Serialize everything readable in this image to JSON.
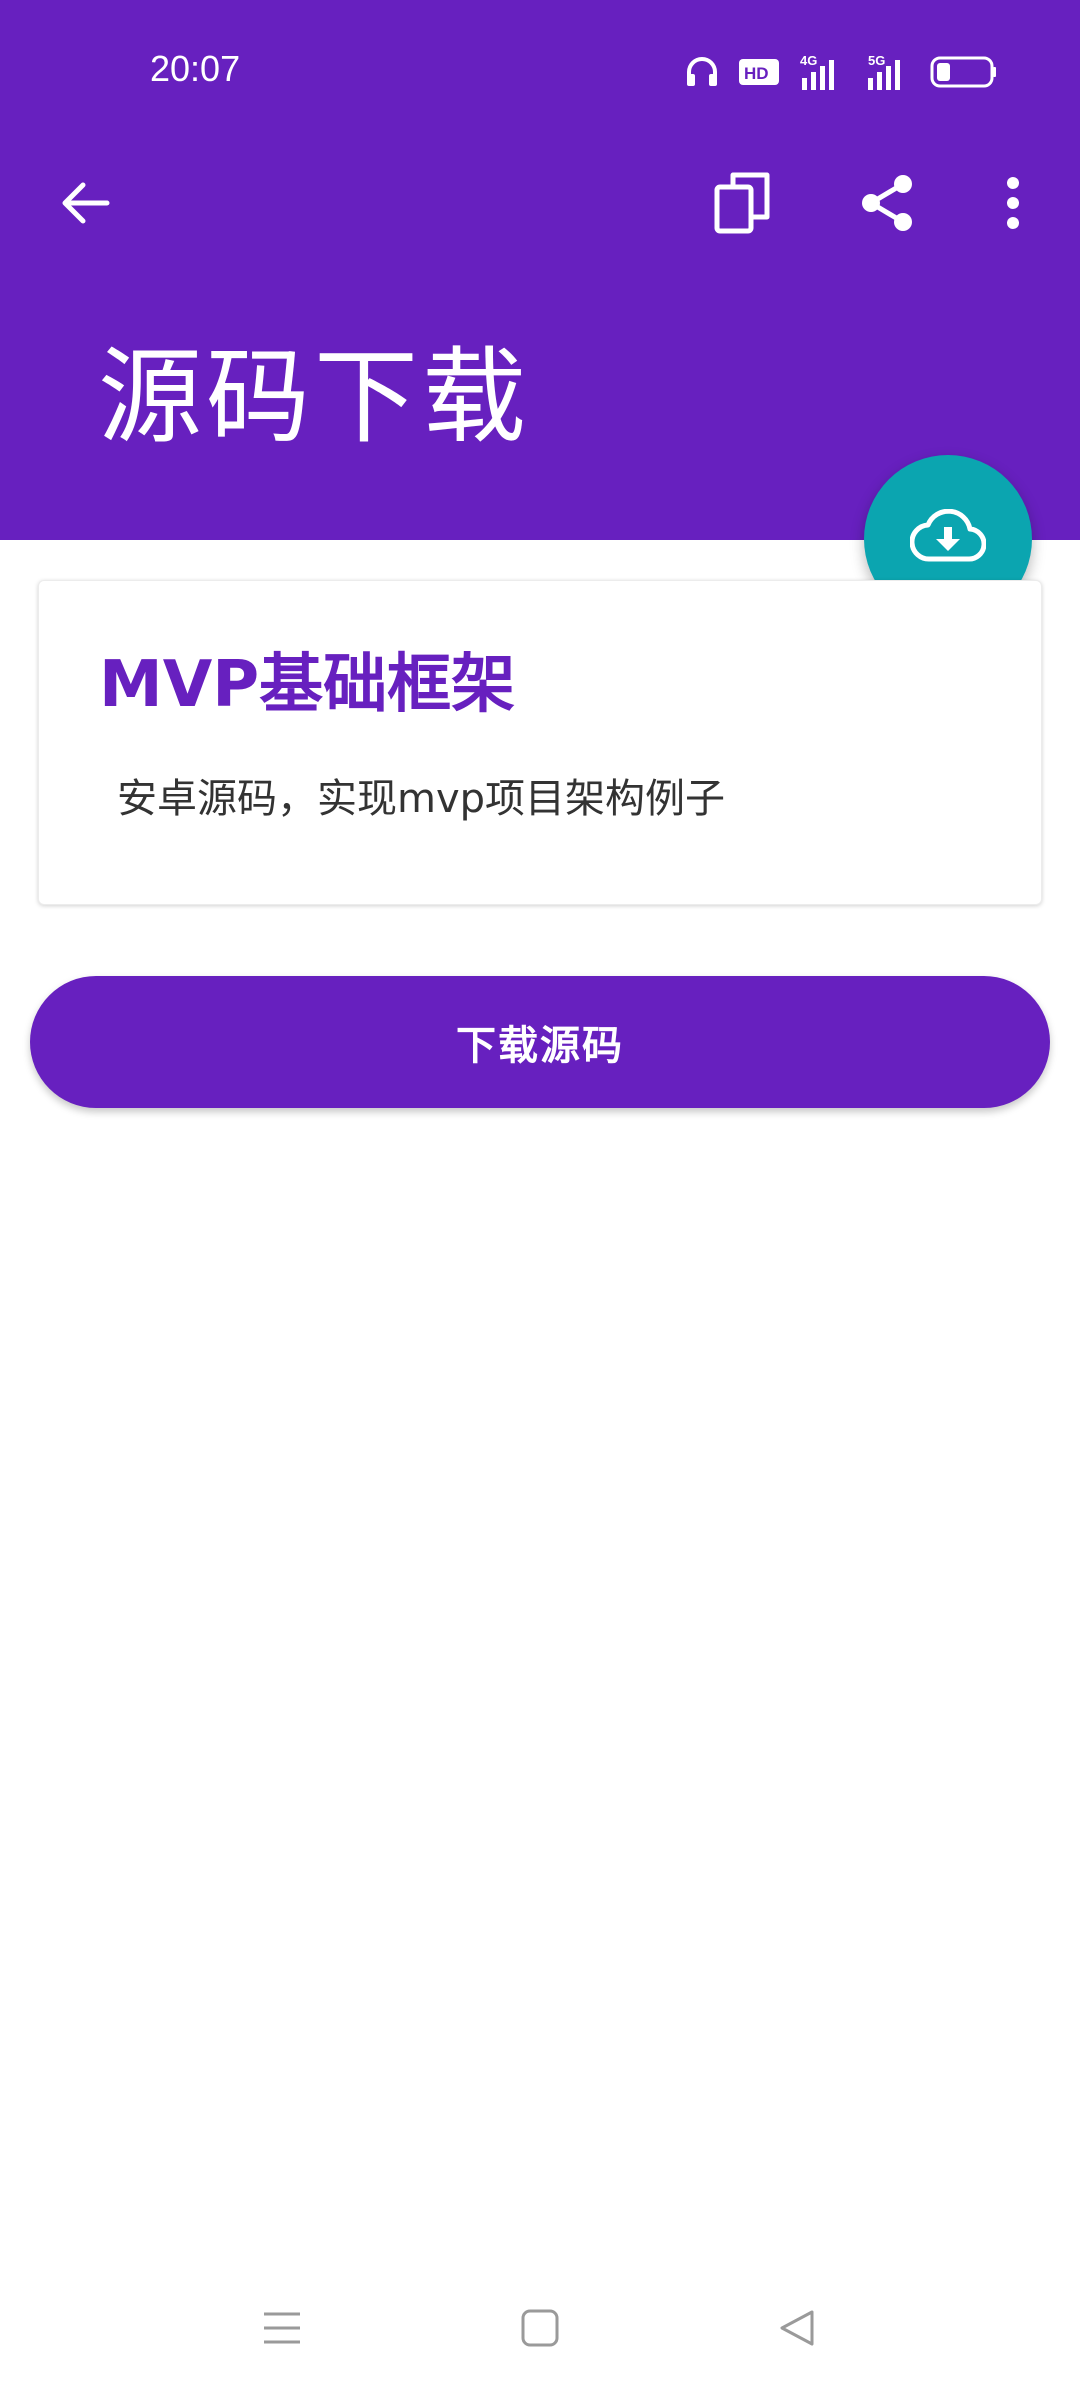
{
  "status_bar": {
    "time": "20:07",
    "icons": [
      "headphones-icon",
      "hd-icon",
      "signal-4g-icon",
      "signal-5g-icon",
      "battery-icon"
    ],
    "hd_label": "HD",
    "network_4g": "4G",
    "network_5g": "5G",
    "battery_level": 0.25
  },
  "toolbar": {
    "back_icon": "arrow-back-icon",
    "copy_icon": "copy-icon",
    "share_icon": "share-icon",
    "more_icon": "more-vert-icon"
  },
  "header": {
    "title": "源码下载"
  },
  "fab": {
    "icon": "cloud-download-icon"
  },
  "card": {
    "title": "MVP基础框架",
    "description": "安卓源码，实现mvp项目架构例子"
  },
  "action": {
    "download_label": "下载源码"
  },
  "nav_bar": {
    "icons": [
      "menu-icon",
      "home-square-icon",
      "back-triangle-icon"
    ]
  },
  "colors": {
    "primary": "#6720BF",
    "accent": "#0BA5B0",
    "background": "#FFFFFF",
    "text_dark": "#333333"
  }
}
